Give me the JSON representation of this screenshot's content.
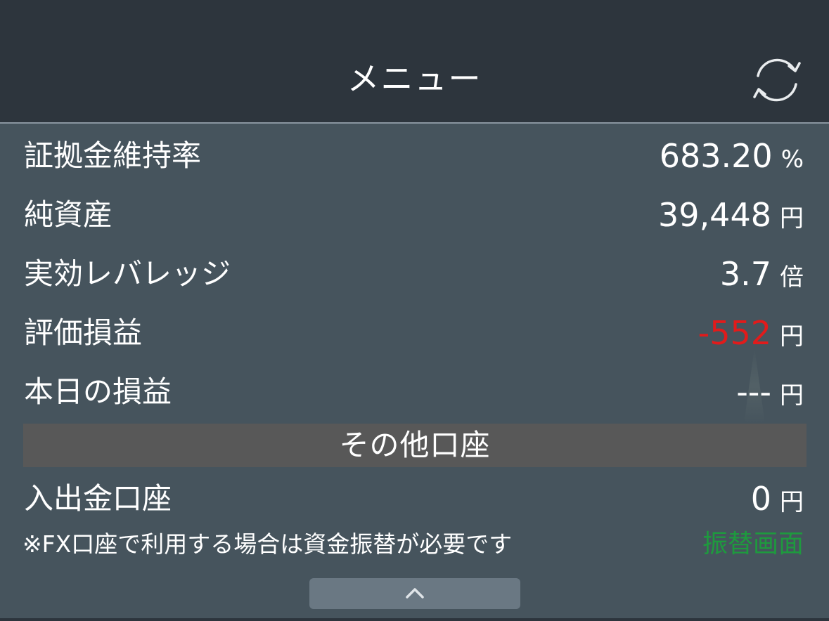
{
  "header": {
    "title": "メニュー",
    "refresh_icon": "refresh-icon"
  },
  "summary": {
    "margin_ratio": {
      "label": "証拠金維持率",
      "value": "683.20",
      "unit": "%"
    },
    "net_assets": {
      "label": "純資産",
      "value": "39,448",
      "unit": "円"
    },
    "effective_leverage": {
      "label": "実効レバレッジ",
      "value": "3.7",
      "unit": "倍"
    },
    "unrealized_pl": {
      "label": "評価損益",
      "value": "-552",
      "unit": "円"
    },
    "today_pl": {
      "label": "本日の損益",
      "value": "---",
      "unit": "円"
    }
  },
  "other_accounts": {
    "section_title": "その他口座",
    "deposit_account": {
      "label": "入出金口座",
      "value": "0",
      "unit": "円"
    },
    "note": "※FX口座で利用する場合は資金振替が必要です",
    "transfer_link": "振替画面"
  },
  "collapse_icon": "chevron-up-icon",
  "colors": {
    "header_bg": "#2d353d",
    "body_bg": "#46545d",
    "negative": "#e11b1b",
    "link": "#1e9a3e",
    "section_bg": "#585858"
  }
}
